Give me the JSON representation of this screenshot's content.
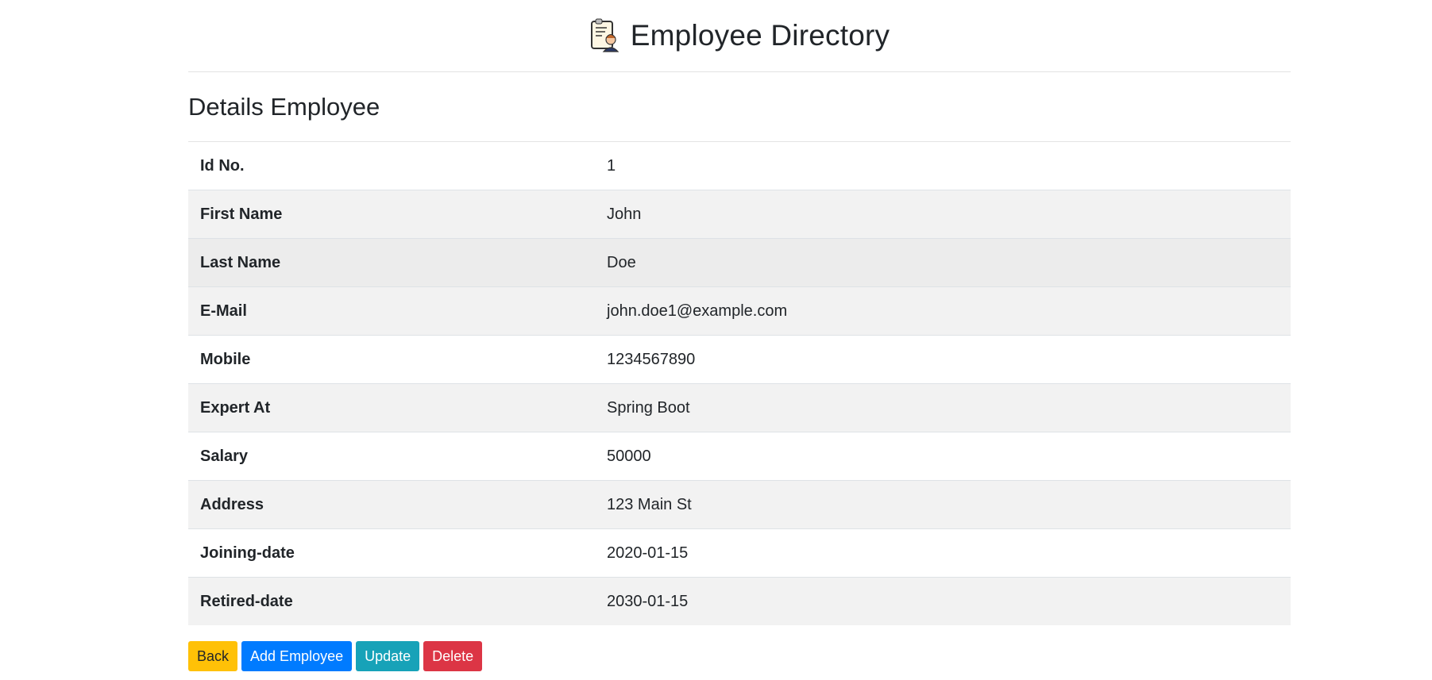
{
  "header": {
    "title": "Employee Directory",
    "logo_icon": "employee-id-card-icon"
  },
  "section_title": "Details Employee",
  "details": [
    {
      "label": "Id No.",
      "value": "1"
    },
    {
      "label": "First Name",
      "value": "John"
    },
    {
      "label": "Last Name",
      "value": "Doe"
    },
    {
      "label": "E-Mail",
      "value": "john.doe1@example.com"
    },
    {
      "label": "Mobile",
      "value": "1234567890"
    },
    {
      "label": "Expert At",
      "value": "Spring Boot"
    },
    {
      "label": "Salary",
      "value": "50000"
    },
    {
      "label": "Address",
      "value": "123 Main St"
    },
    {
      "label": "Joining-date",
      "value": "2020-01-15"
    },
    {
      "label": "Retired-date",
      "value": "2030-01-15"
    }
  ],
  "actions": {
    "back_label": "Back",
    "add_label": "Add Employee",
    "update_label": "Update",
    "delete_label": "Delete"
  },
  "colors": {
    "back": "#ffc107",
    "add": "#007bff",
    "update": "#17a2b8",
    "delete": "#dc3545",
    "stripe": "#f2f2f2"
  }
}
